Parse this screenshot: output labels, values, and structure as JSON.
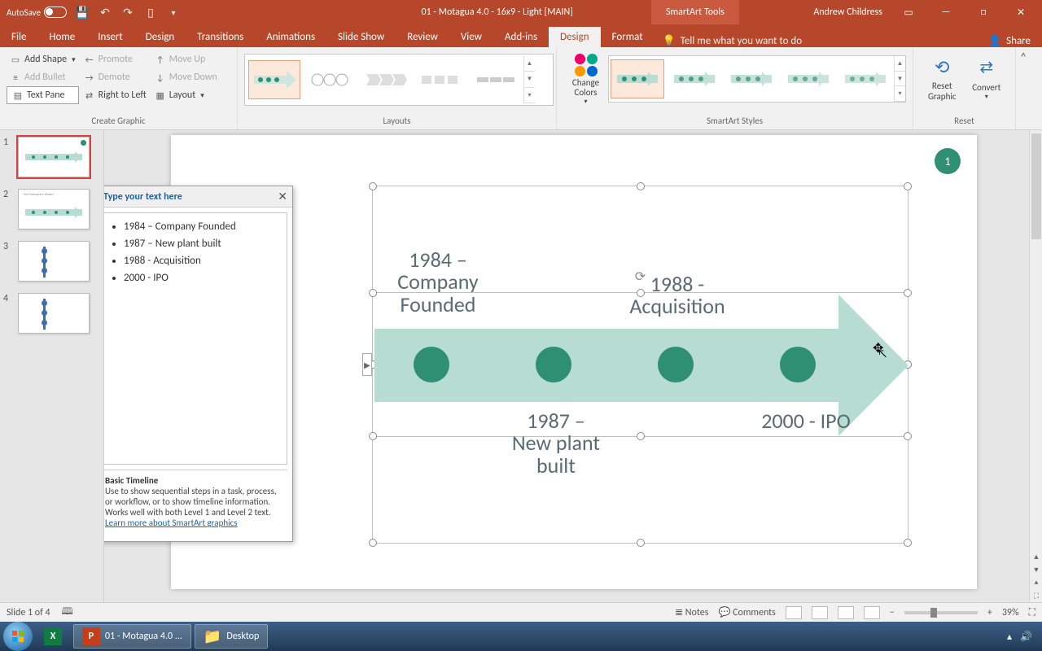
{
  "titlebar": {
    "autosave": "AutoSave",
    "doc_title": "01 - Motagua 4.0 - 16x9 - Light [MAIN]",
    "context_tab": "SmartArt Tools",
    "user": "Andrew Childress"
  },
  "tabs": {
    "file": "File",
    "home": "Home",
    "insert": "Insert",
    "design": "Design",
    "transitions": "Transitions",
    "animations": "Animations",
    "slideshow": "Slide Show",
    "review": "Review",
    "view": "View",
    "addins": "Add-ins",
    "sa_design": "Design",
    "format": "Format",
    "tellme": "Tell me what you want to do",
    "share": "Share"
  },
  "ribbon": {
    "add_shape": "Add Shape",
    "add_bullet": "Add Bullet",
    "text_pane": "Text Pane",
    "promote": "Promote",
    "demote": "Demote",
    "rtl": "Right to Left",
    "move_up": "Move Up",
    "move_down": "Move Down",
    "layout_btn": "Layout",
    "group_create": "Create Graphic",
    "group_layouts": "Layouts",
    "change_colors": "Change Colors",
    "group_styles": "SmartArt Styles",
    "reset_graphic": "Reset Graphic",
    "convert": "Convert",
    "group_reset": "Reset"
  },
  "textpane": {
    "header": "Type your text here",
    "items": [
      "1984  – Company Founded",
      "1987 – New plant built",
      "1988  - Acquisition",
      "2000  - IPO"
    ],
    "title": "Basic Timeline",
    "desc": "Use to show sequential steps in a task, process, or workflow, or to show timeline information. Works well with both Level 1 and Level 2 text.",
    "link": "Learn more about SmartArt graphics"
  },
  "timeline": {
    "badge": "1",
    "items": [
      {
        "top": "1984 – Company Founded",
        "bottom": ""
      },
      {
        "top": "",
        "bottom": "1987 – New plant built"
      },
      {
        "top": "1988 - Acquisition",
        "bottom": ""
      },
      {
        "top": "",
        "bottom": "2000 - IPO"
      }
    ],
    "label1": "1984 –\nCompany\nFounded",
    "label2": "1987 –\nNew plant\nbuilt",
    "label3": "1988 -\nAcquisition",
    "label4": "2000 - IPO"
  },
  "status": {
    "slide": "Slide 1 of 4",
    "notes": "Notes",
    "comments": "Comments",
    "zoom": "39%"
  },
  "taskbar": {
    "ppt": "01 - Motagua 4.0 ...",
    "desktop": "Desktop"
  }
}
